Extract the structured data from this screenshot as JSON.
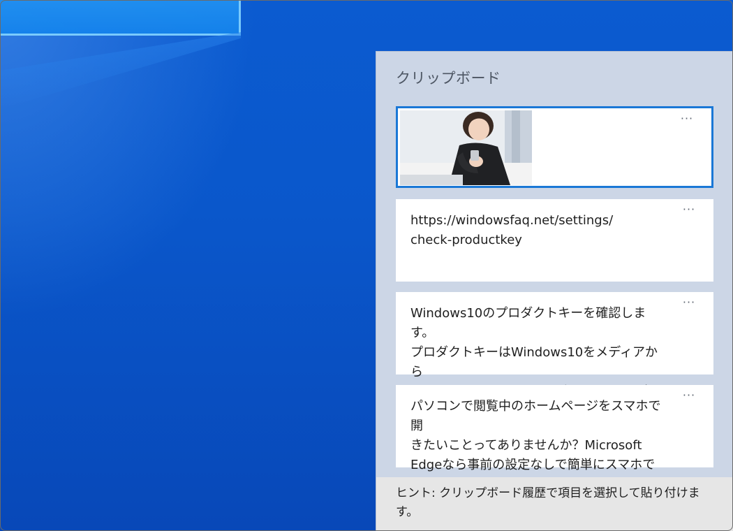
{
  "clipboard": {
    "title": "クリップボード",
    "items": [
      {
        "type": "image",
        "more_icon": "ellipsis-icon",
        "more_label": "···"
      },
      {
        "type": "text",
        "text": "https://windowsfaq.net/settings/\ncheck-productkey",
        "more_label": "···"
      },
      {
        "type": "text",
        "text": "Windows10のプロダクトキーを確認します。\nプロダクトキーはWindows10をメディアから\n再インストールするときに必要です。万が一",
        "more_label": "···"
      },
      {
        "type": "text",
        "text": "パソコンで閲覧中のホームページをスマホで開\nきたいことってありませんか？Microsoft\nEdgeなら事前の設定なしで簡単にスマホで",
        "more_label": "···"
      }
    ],
    "hint": "ヒント: クリップボード履歴で項目を選択して貼り付けます。"
  },
  "colors": {
    "desktop": "#0a56c7",
    "panel": "#ccd6e6",
    "selection": "#1a78d6"
  }
}
